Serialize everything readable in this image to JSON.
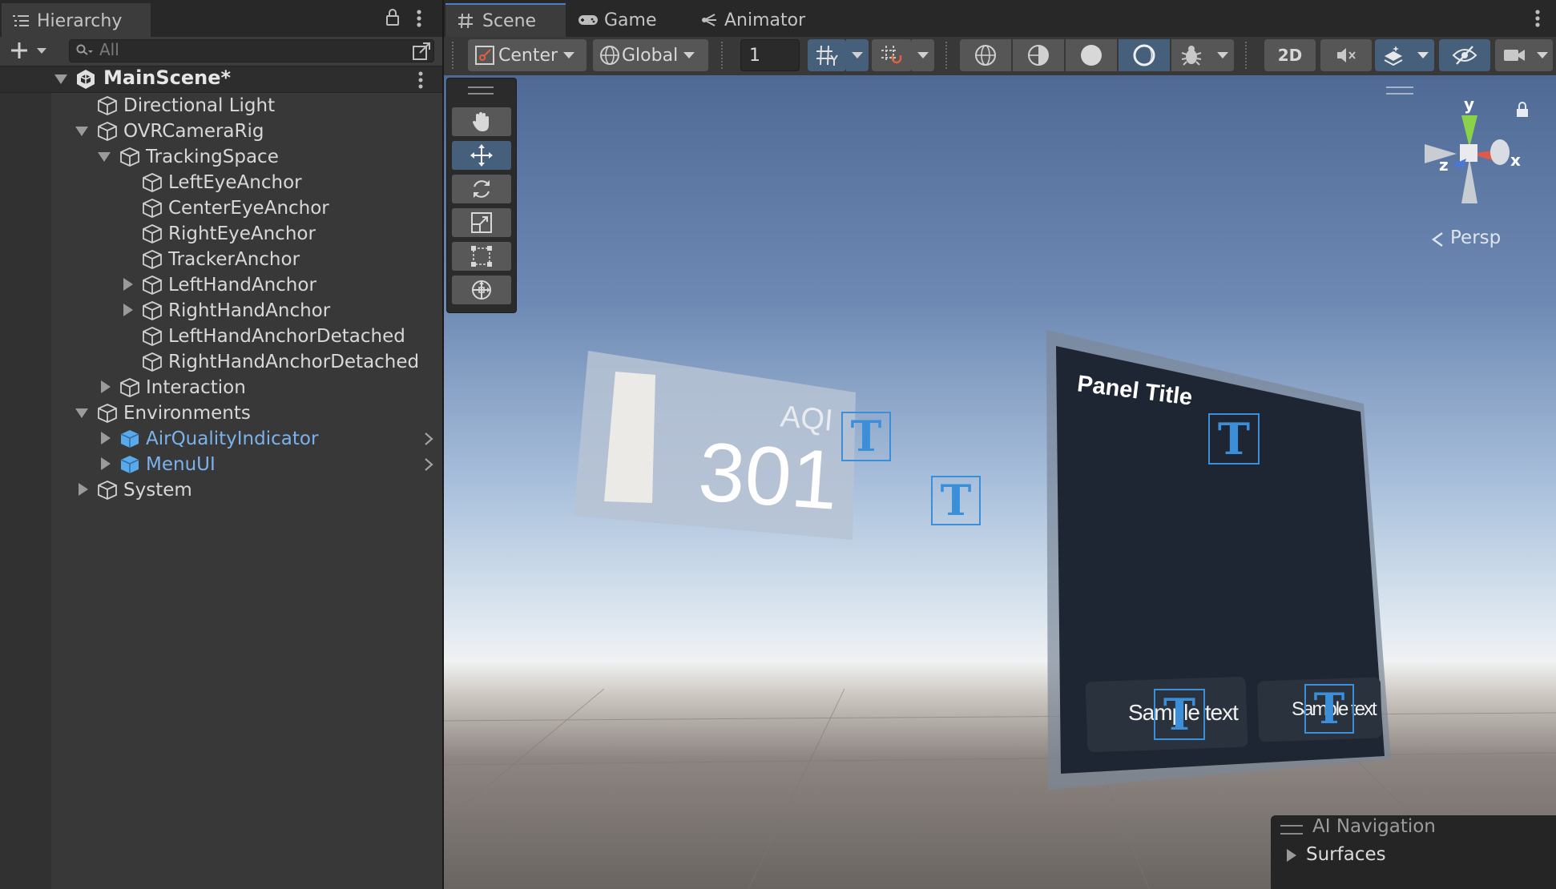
{
  "hierarchy": {
    "tab_label": "Hierarchy",
    "search_placeholder": "All",
    "scene_name": "MainScene*",
    "items": [
      {
        "label": "Directional Light"
      },
      {
        "label": "OVRCameraRig"
      },
      {
        "label": "TrackingSpace"
      },
      {
        "label": "LeftEyeAnchor"
      },
      {
        "label": "CenterEyeAnchor"
      },
      {
        "label": "RightEyeAnchor"
      },
      {
        "label": "TrackerAnchor"
      },
      {
        "label": "LeftHandAnchor"
      },
      {
        "label": "RightHandAnchor"
      },
      {
        "label": "LeftHandAnchorDetached"
      },
      {
        "label": "RightHandAnchorDetached"
      },
      {
        "label": "Interaction"
      },
      {
        "label": "Environments"
      },
      {
        "label": "AirQualityIndicator"
      },
      {
        "label": "MenuUI"
      },
      {
        "label": "System"
      }
    ]
  },
  "scene_tabs": [
    {
      "label": "Scene"
    },
    {
      "label": "Game"
    },
    {
      "label": "Animator"
    }
  ],
  "scene_toolbar": {
    "pivot_label": "Center",
    "space_label": "Global",
    "grid_size_value": "1",
    "mode_2d_label": "2D"
  },
  "scene_view": {
    "aqi_label": "AQI",
    "aqi_value": "301",
    "panel_title": "Panel Title",
    "button1_text": "Sample text",
    "button2_text": "Sample text",
    "gizmo_y": "y",
    "gizmo_x": "x",
    "gizmo_z": "z",
    "projection_label": "Persp"
  },
  "overlay": {
    "title": "AI Navigation",
    "item": "Surfaces"
  },
  "colors": {
    "selected_blue": "#46607c",
    "prefab_text": "#7cb2ec",
    "text_gizmo": "#3b8fd8"
  }
}
